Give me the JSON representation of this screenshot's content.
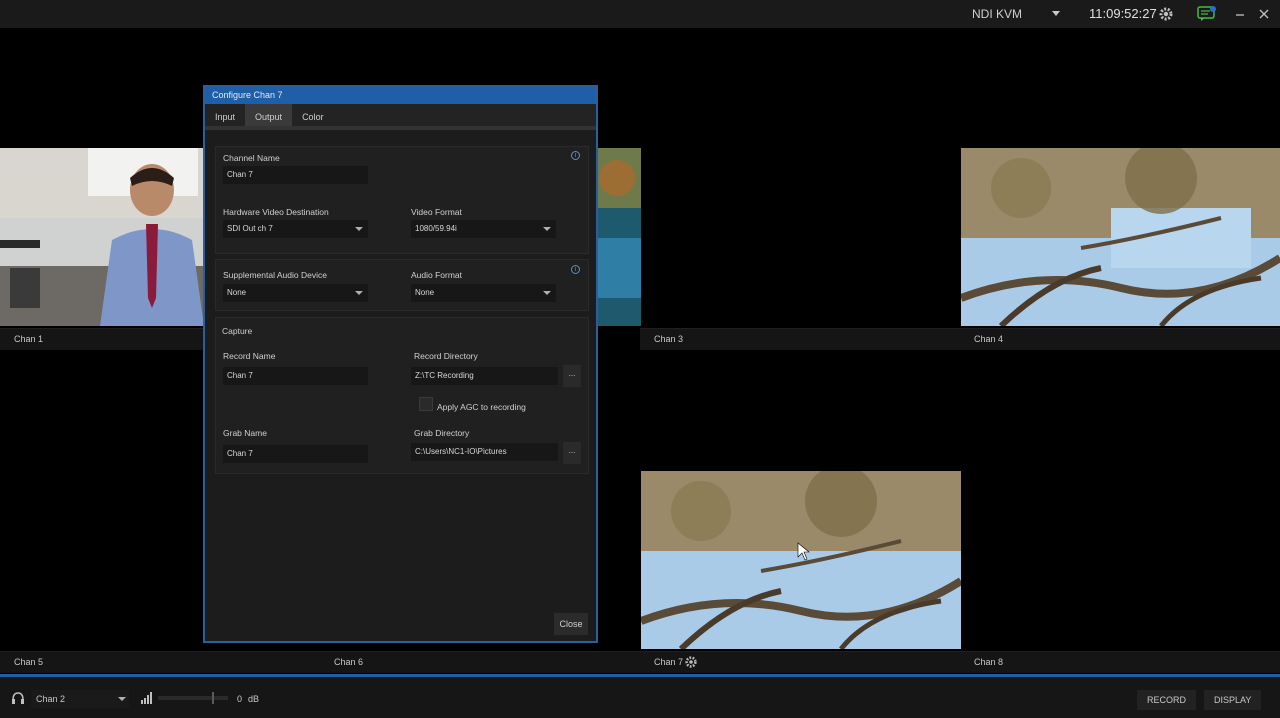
{
  "topbar": {
    "kvm_label": "NDI KVM",
    "clock": "11:09:52:27",
    "icons": [
      "gear-icon",
      "notifications-icon",
      "minimize-icon",
      "close-icon"
    ]
  },
  "channels": [
    {
      "label": "Chan 1"
    },
    {
      "label": "Chan 3"
    },
    {
      "label": "Chan 4"
    },
    {
      "label": "Chan 5"
    },
    {
      "label": "Chan 6"
    },
    {
      "label": "Chan 7"
    },
    {
      "label": "Chan 8"
    }
  ],
  "dialog": {
    "title": "Configure Chan 7",
    "tabs": [
      "Input",
      "Output",
      "Color"
    ],
    "active_tab": "Output",
    "channel_name_label": "Channel Name",
    "channel_name_value": "Chan 7",
    "hw_dest_label": "Hardware Video Destination",
    "hw_dest_value": "SDI Out ch 7",
    "video_format_label": "Video Format",
    "video_format_value": "1080/59.94i",
    "supp_audio_label": "Supplemental Audio Device",
    "supp_audio_value": "None",
    "audio_format_label": "Audio Format",
    "audio_format_value": "None",
    "capture_label": "Capture",
    "record_name_label": "Record Name",
    "record_name_value": "Chan 7",
    "record_dir_label": "Record Directory",
    "record_dir_value": "Z:\\TC Recording",
    "agc_label": "Apply AGC to recording",
    "grab_name_label": "Grab Name",
    "grab_name_value": "Chan 7",
    "grab_dir_label": "Grab Directory",
    "grab_dir_value": "C:\\Users\\NC1-IO\\Pictures",
    "browse_label": "...",
    "close_label": "Close"
  },
  "bottombar": {
    "audio_source": "Chan 2",
    "volume_value": "0",
    "volume_unit": "dB",
    "record_label": "RECORD",
    "display_label": "DISPLAY"
  }
}
